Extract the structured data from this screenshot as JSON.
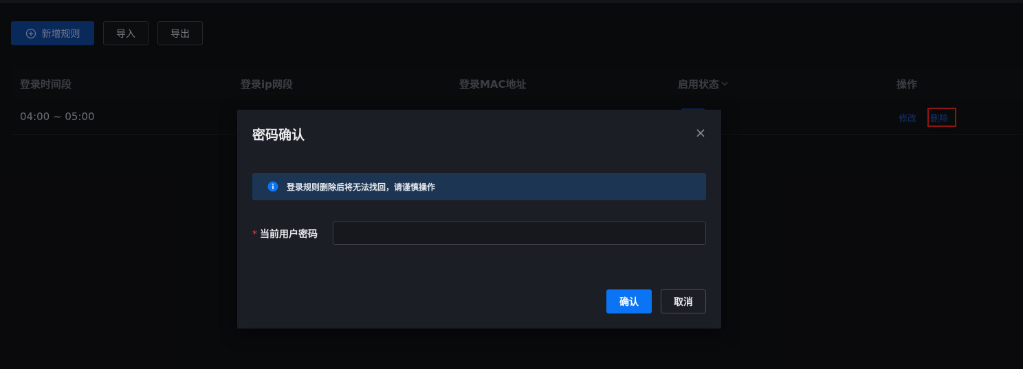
{
  "toolbar": {
    "add_label": "新增规则",
    "import_label": "导入",
    "export_label": "导出"
  },
  "table": {
    "columns": [
      "登录时间段",
      "登录ip网段",
      "登录MAC地址",
      "启用状态",
      "操作"
    ],
    "rows": [
      {
        "time_range": "04:00 ~ 05:00",
        "edit_label": "修改",
        "delete_label": "删除"
      }
    ]
  },
  "modal": {
    "title": "密码确认",
    "alert_text": "登录规则删除后将无法找回，请谨慎操作",
    "required_mark": "*",
    "field_label": "当前用户密码",
    "password_value": "",
    "confirm_label": "确认",
    "cancel_label": "取消"
  },
  "colors": {
    "primary": "#0a74f4",
    "alert_bg": "#1c3552",
    "highlight_box": "#d9231f"
  }
}
